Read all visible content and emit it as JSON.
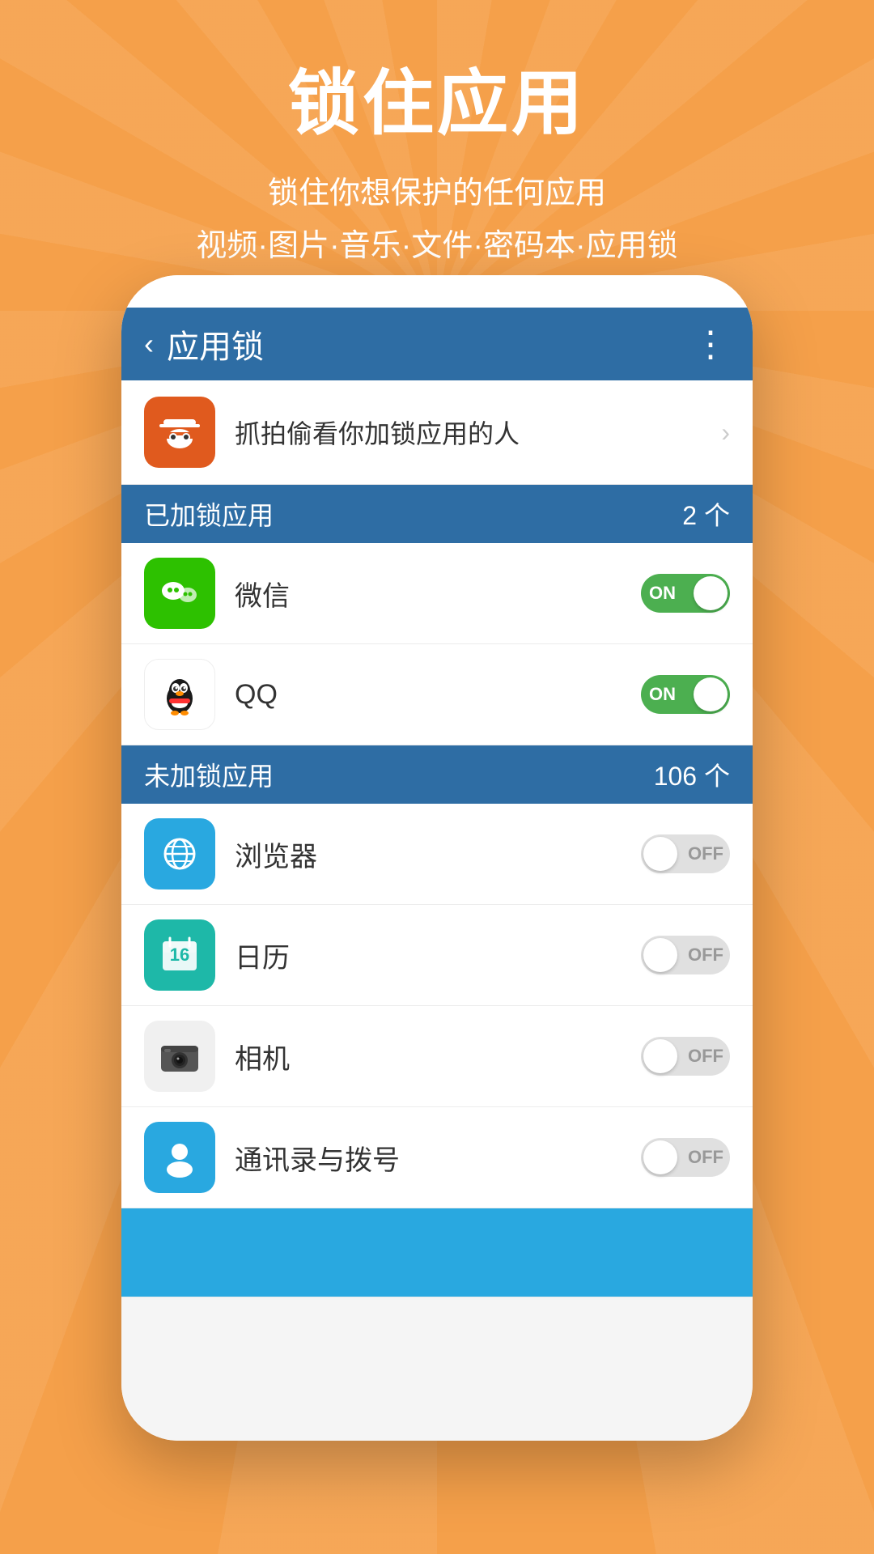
{
  "background": {
    "color": "#F5A04A"
  },
  "header": {
    "main_title": "锁住应用",
    "sub_title_1": "锁住你想保护的任何应用",
    "sub_title_2": "视频·图片·音乐·文件·密码本·应用锁"
  },
  "top_bar": {
    "back_label": "‹",
    "title": "应用锁",
    "menu_label": "⋮"
  },
  "spy_row": {
    "text": "抓拍偷看你加锁应用的人"
  },
  "locked_section": {
    "label": "已加锁应用",
    "count": "2 个"
  },
  "locked_apps": [
    {
      "name": "微信",
      "toggle_state": "on",
      "toggle_label_on": "ON",
      "icon_type": "wechat"
    },
    {
      "name": "QQ",
      "toggle_state": "on",
      "toggle_label_on": "ON",
      "icon_type": "qq"
    }
  ],
  "unlocked_section": {
    "label": "未加锁应用",
    "count": "106 个"
  },
  "unlocked_apps": [
    {
      "name": "浏览器",
      "toggle_state": "off",
      "toggle_label_off": "OFF",
      "icon_type": "browser"
    },
    {
      "name": "日历",
      "toggle_state": "off",
      "toggle_label_off": "OFF",
      "icon_type": "calendar"
    },
    {
      "name": "相机",
      "toggle_state": "off",
      "toggle_label_off": "OFF",
      "icon_type": "camera"
    },
    {
      "name": "通讯录与拨号",
      "toggle_state": "off",
      "toggle_label_off": "OFF",
      "icon_type": "contacts"
    }
  ]
}
